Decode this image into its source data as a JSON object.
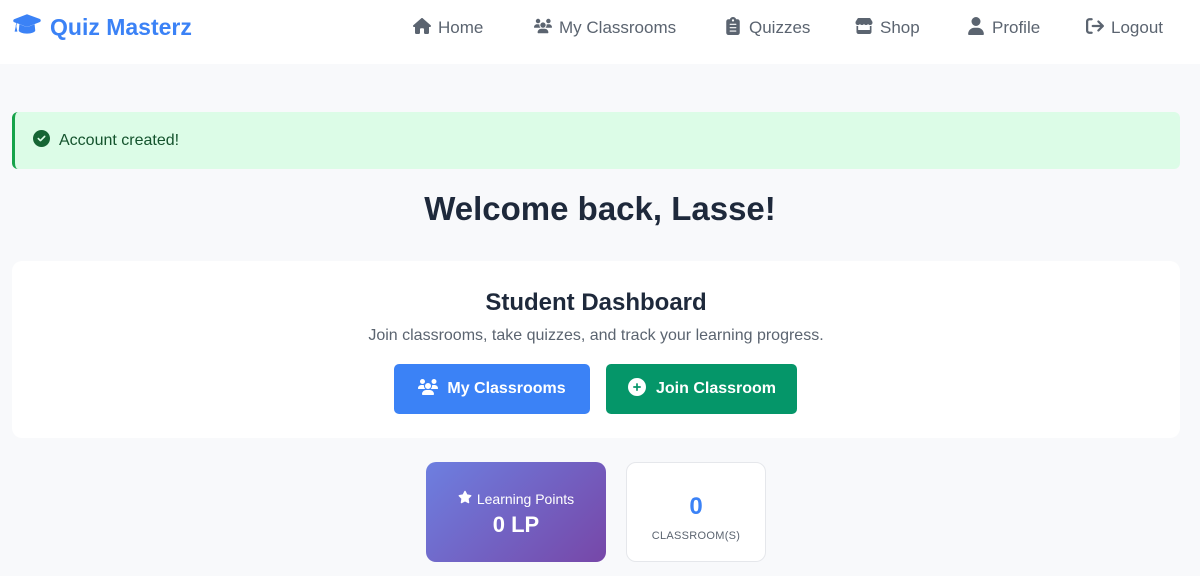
{
  "app": {
    "brand": "Quiz Masterz",
    "brand_icon": "graduation-cap-icon",
    "accent_color": "#3b82f6"
  },
  "nav": {
    "items": [
      {
        "label": "Home",
        "icon": "home-icon"
      },
      {
        "label": "My Classrooms",
        "icon": "users-icon"
      },
      {
        "label": "Quizzes",
        "icon": "clipboard-icon"
      },
      {
        "label": "Shop",
        "icon": "store-icon"
      },
      {
        "label": "Profile",
        "icon": "user-icon"
      },
      {
        "label": "Logout",
        "icon": "logout-icon"
      }
    ]
  },
  "alert": {
    "message": "Account created!",
    "icon": "check-circle-icon",
    "color": "#16a34a"
  },
  "welcome": {
    "title": "Welcome back, Lasse!"
  },
  "dashboard": {
    "title": "Student Dashboard",
    "subtitle": "Join classrooms, take quizzes, and track your learning progress.",
    "my_classrooms_button": "My Classrooms",
    "join_classroom_button": "Join Classroom"
  },
  "stats": {
    "learning_points_label": "Learning Points",
    "learning_points_value": "0 LP",
    "classrooms_value": "0",
    "classrooms_label": "CLASSROOM(S)"
  }
}
